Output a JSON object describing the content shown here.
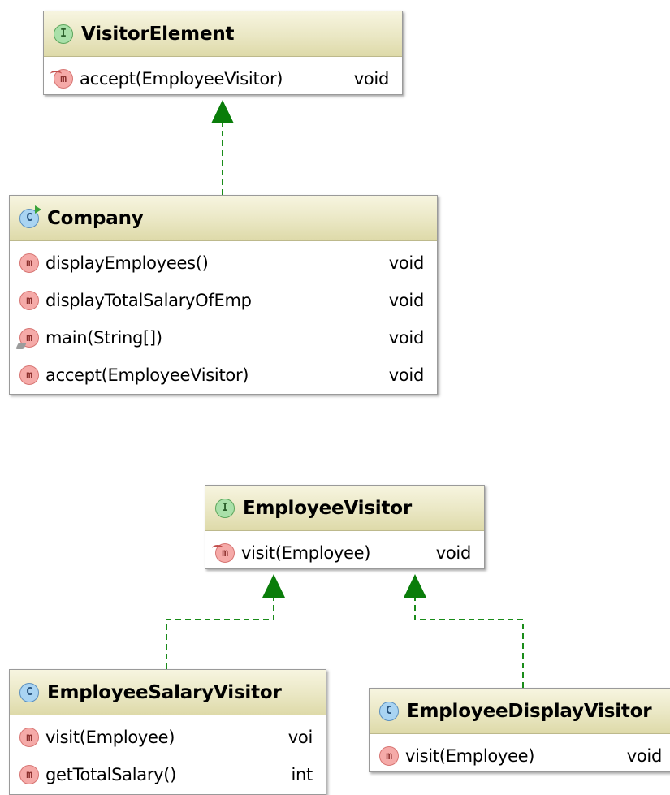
{
  "diagram": {
    "boxes": [
      {
        "id": "visitor-element",
        "kind": "interface",
        "kind_letter": "I",
        "name": "VisitorElement",
        "members": [
          {
            "signature": "accept(EmployeeVisitor)",
            "returns": "void",
            "modifier": "abstract"
          }
        ]
      },
      {
        "id": "company",
        "kind": "class",
        "kind_letter": "C",
        "runnable": true,
        "name": "Company",
        "members": [
          {
            "signature": "displayEmployees()",
            "returns": "void",
            "modifier": ""
          },
          {
            "signature": "displayTotalSalaryOfEmp",
            "returns": "void",
            "modifier": ""
          },
          {
            "signature": "main(String[])",
            "returns": "void",
            "modifier": "static"
          },
          {
            "signature": "accept(EmployeeVisitor)",
            "returns": "void",
            "modifier": ""
          }
        ]
      },
      {
        "id": "employee-visitor",
        "kind": "interface",
        "kind_letter": "I",
        "name": "EmployeeVisitor",
        "members": [
          {
            "signature": "visit(Employee)",
            "returns": "void",
            "modifier": "abstract"
          }
        ]
      },
      {
        "id": "employee-salary-visitor",
        "kind": "class",
        "kind_letter": "C",
        "name": "EmployeeSalaryVisitor",
        "members": [
          {
            "signature": "visit(Employee)",
            "returns": "voi",
            "modifier": ""
          },
          {
            "signature": "getTotalSalary()",
            "returns": "int",
            "modifier": ""
          }
        ]
      },
      {
        "id": "employee-display-visitor",
        "kind": "class",
        "kind_letter": "C",
        "name": "EmployeeDisplayVisitor",
        "members": [
          {
            "signature": "visit(Employee)",
            "returns": "void",
            "modifier": ""
          }
        ]
      }
    ],
    "relations": [
      {
        "from": "company",
        "to": "visitor-element",
        "type": "realization"
      },
      {
        "from": "employee-salary-visitor",
        "to": "employee-visitor",
        "type": "realization"
      },
      {
        "from": "employee-display-visitor",
        "to": "employee-visitor",
        "type": "realization"
      }
    ],
    "method_icon_letter": "m",
    "colors": {
      "relation_line": "#1a8c1a",
      "arrow_head": "#0a7d0a",
      "interface_icon": "#a9e0a9",
      "class_icon": "#a9d4f2",
      "method_icon": "#f5aaa8",
      "header_fill": "#eae7c4"
    }
  }
}
